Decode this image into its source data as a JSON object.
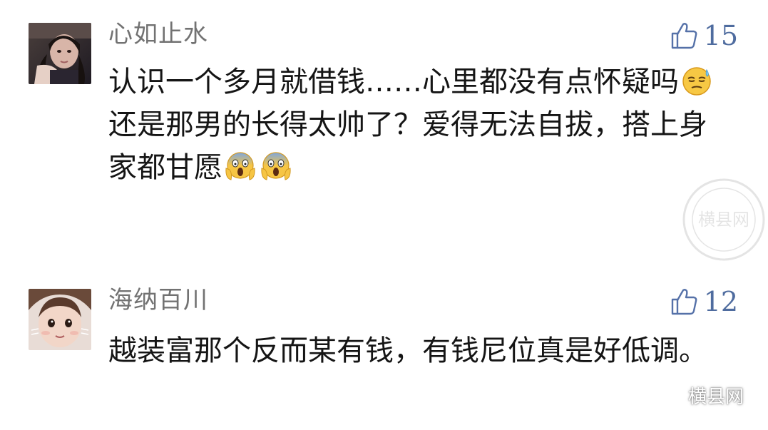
{
  "comments": [
    {
      "username": "心如止水",
      "likes": "15",
      "text_lines": [
        "认识一个多月就借钱……心里都没有点怀疑吗"
      ],
      "emoji_after_line1": "sweat-smile-emoji",
      "text_line2": "还是那男的长得太帅了？爱得无法自拔，搭上身家都甘愿",
      "emoji_after_line2": [
        "scream-emoji",
        "scream-emoji"
      ]
    },
    {
      "username": "海纳百川",
      "likes": "12",
      "text": "越装富那个反而某有钱，有钱尼位真是好低调。"
    }
  ],
  "brand": {
    "label": "横县网",
    "icon": "wechat-icon"
  },
  "watermark": {
    "label": "横县网"
  },
  "colors": {
    "username": "#727272",
    "likes": "#4f6c9f",
    "text": "#151515",
    "background": "#ffffff"
  }
}
